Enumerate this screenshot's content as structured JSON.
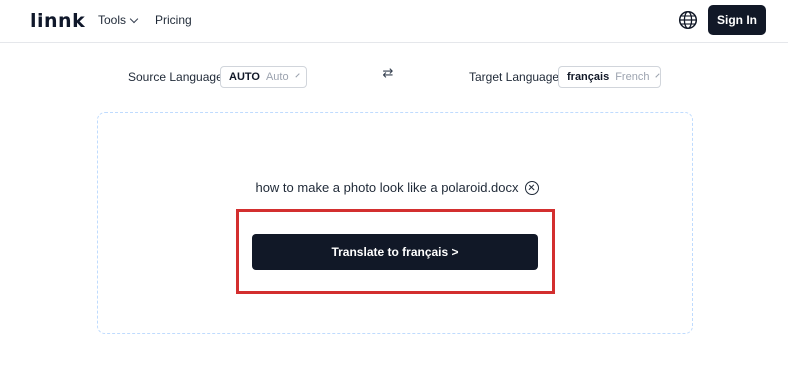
{
  "header": {
    "logo": "linnk",
    "nav": {
      "tools_label": "Tools",
      "pricing_label": "Pricing"
    },
    "signin_label": "Sign In"
  },
  "languages": {
    "source_label": "Source Language",
    "source_code": "AUTO",
    "source_name": "Auto",
    "swap_glyph": "⇄",
    "target_label": "Target Language",
    "target_code": "français",
    "target_name": "French"
  },
  "upload": {
    "file_name": "how to make a photo look like a polaroid.docx",
    "translate_button_label": "Translate to français >"
  },
  "colors": {
    "primary_dark": "#111827",
    "highlight_red": "#d32f2f",
    "dropzone_border": "#bfdbfe"
  }
}
